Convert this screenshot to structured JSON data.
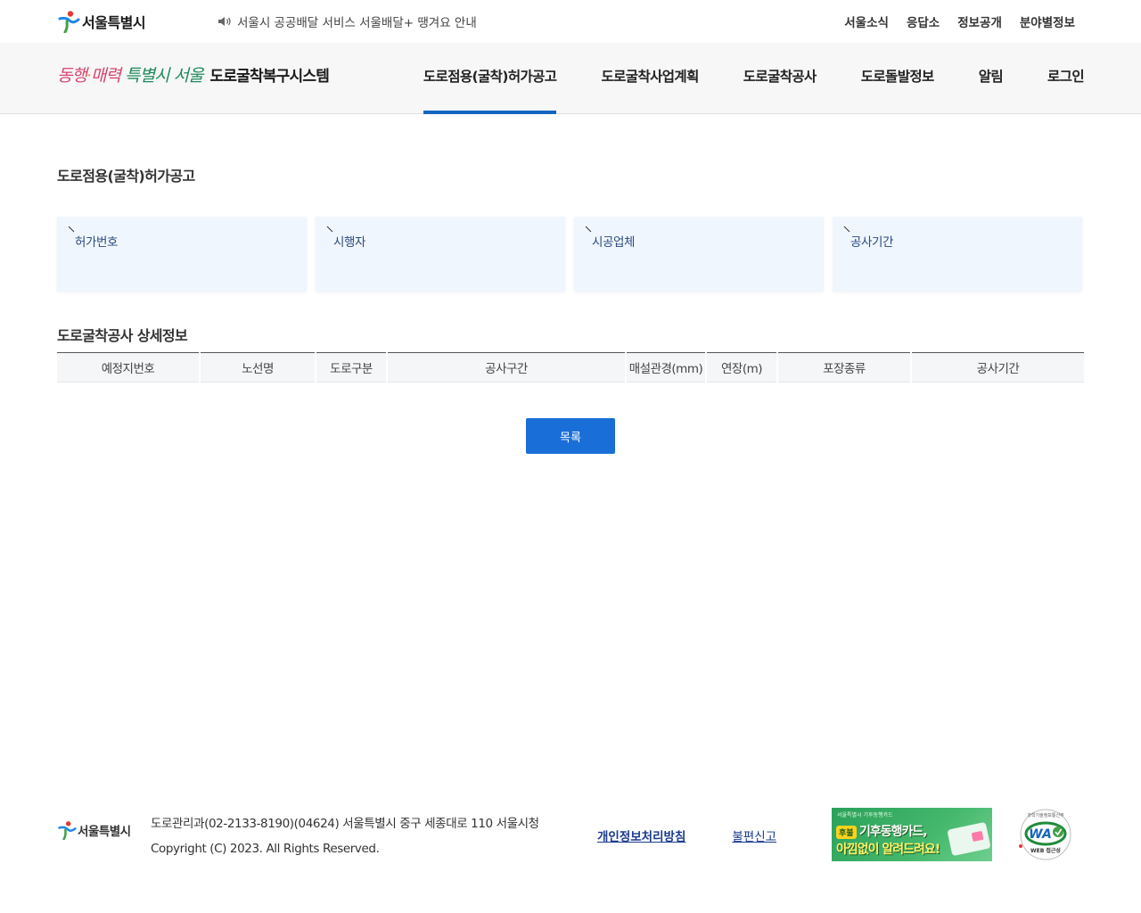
{
  "top": {
    "logo_text": "서울특별시",
    "notice": "서울시 공공배달 서비스 서울배달+ 땡겨요 안내",
    "links": [
      "서울소식",
      "응답소",
      "정보공개",
      "분야별정보"
    ]
  },
  "header": {
    "slogan": {
      "p1": "동행",
      "dot": "·",
      "p2": "매력",
      "g": "특별시 서울"
    },
    "system_title": "도로굴착복구시스템",
    "nav": [
      "도로점용(굴착)허가공고",
      "도로굴착사업계획",
      "도로굴착공사",
      "도로돌발정보",
      "알림",
      "로그인"
    ],
    "active_index": 0
  },
  "main": {
    "page_title": "도로점용(굴착)허가공고",
    "cards": [
      {
        "label": "허가번호",
        "value": ""
      },
      {
        "label": "시행자",
        "value": ""
      },
      {
        "label": "시공업체",
        "value": ""
      },
      {
        "label": "공사기간",
        "value": ""
      }
    ],
    "detail_title": "도로굴착공사 상세정보",
    "table_headers": [
      "예정지번호",
      "노선명",
      "도로구분",
      "공사구간",
      "매설관경(mm)",
      "연장(m)",
      "포장종류",
      "공사기간"
    ],
    "list_button": "목록"
  },
  "footer": {
    "logo_text": "서울특별시",
    "address": "도로관리과(02-2133-8190)(04624) 서울특별시 중구 세종대로 110 서울시청",
    "copyright": "Copyright (C) 2023. All Rights Reserved.",
    "privacy_link": "개인정보처리방침",
    "report_link": "불편신고",
    "banner": {
      "small": "서울특별시 기후동행카드",
      "badge": "후불",
      "line1": "기후동행카드,",
      "line2": "아낌없이 알려드려요!"
    },
    "wa_mark": {
      "top": "과학기술정보통신부",
      "main": "WA",
      "sub": "WEB 접근성"
    }
  },
  "colors": {
    "accent": "#1565c0",
    "button": "#1a6ed8",
    "card_bg": "#f0f6fd",
    "slogan_pink": "#d8446e",
    "slogan_green": "#1f8a5b"
  }
}
